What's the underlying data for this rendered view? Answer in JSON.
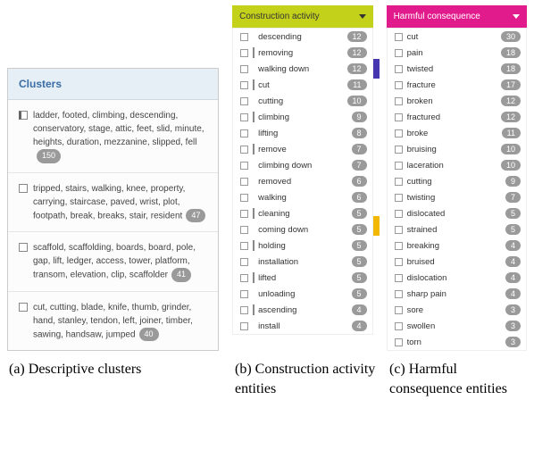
{
  "panelA": {
    "header": "Clusters",
    "items": [
      {
        "text": "ladder, footed, climbing, descending, conservatory, stage, attic, feet, slid, minute, heights, duration, mezzanine, slipped, fell",
        "count": "150",
        "bar": true
      },
      {
        "text": "tripped, stairs, walking, knee, property, carrying, staircase, paved, wrist, plot, footpath, break, breaks, stair, resident",
        "count": "47",
        "bar": false
      },
      {
        "text": "scaffold, scaffolding, boards, board, pole, gap, lift, ledger, access, tower, platform, transom, elevation, clip, scaffolder",
        "count": "41",
        "bar": false
      },
      {
        "text": "cut, cutting, blade, knife, thumb, grinder, hand, stanley, tendon, left, joiner, timber, sawing, handsaw, jumped",
        "count": "40",
        "bar": false
      }
    ]
  },
  "panelB": {
    "header": "Construction activity",
    "items": [
      {
        "text": "descending",
        "count": "12",
        "bar": false
      },
      {
        "text": "removing",
        "count": "12",
        "bar": true
      },
      {
        "text": "walking down",
        "count": "12",
        "bar": false
      },
      {
        "text": "cut",
        "count": "11",
        "bar": true
      },
      {
        "text": "cutting",
        "count": "10",
        "bar": false
      },
      {
        "text": "climbing",
        "count": "9",
        "bar": true
      },
      {
        "text": "lifting",
        "count": "8",
        "bar": false
      },
      {
        "text": "remove",
        "count": "7",
        "bar": true
      },
      {
        "text": "climbing down",
        "count": "7",
        "bar": false
      },
      {
        "text": "removed",
        "count": "6",
        "bar": false
      },
      {
        "text": "walking",
        "count": "6",
        "bar": false
      },
      {
        "text": "cleaning",
        "count": "5",
        "bar": true
      },
      {
        "text": "coming down",
        "count": "5",
        "bar": false
      },
      {
        "text": "holding",
        "count": "5",
        "bar": true
      },
      {
        "text": "installation",
        "count": "5",
        "bar": false
      },
      {
        "text": "lifted",
        "count": "5",
        "bar": true
      },
      {
        "text": "unloading",
        "count": "5",
        "bar": false
      },
      {
        "text": "ascending",
        "count": "4",
        "bar": true
      },
      {
        "text": "install",
        "count": "4",
        "bar": false
      }
    ]
  },
  "panelC": {
    "header": "Harmful consequence",
    "items": [
      {
        "text": "cut",
        "count": "30"
      },
      {
        "text": "pain",
        "count": "18"
      },
      {
        "text": "twisted",
        "count": "18"
      },
      {
        "text": "fracture",
        "count": "17"
      },
      {
        "text": "broken",
        "count": "12"
      },
      {
        "text": "fractured",
        "count": "12"
      },
      {
        "text": "broke",
        "count": "11"
      },
      {
        "text": "bruising",
        "count": "10"
      },
      {
        "text": "laceration",
        "count": "10"
      },
      {
        "text": "cutting",
        "count": "9"
      },
      {
        "text": "twisting",
        "count": "7"
      },
      {
        "text": "dislocated",
        "count": "5"
      },
      {
        "text": "strained",
        "count": "5"
      },
      {
        "text": "breaking",
        "count": "4"
      },
      {
        "text": "bruised",
        "count": "4"
      },
      {
        "text": "dislocation",
        "count": "4"
      },
      {
        "text": "sharp pain",
        "count": "4"
      },
      {
        "text": "sore",
        "count": "3"
      },
      {
        "text": "swollen",
        "count": "3"
      },
      {
        "text": "torn",
        "count": "3"
      }
    ]
  },
  "captions": {
    "a": "(a) Descriptive clusters",
    "b": "(b) Construction activity entities",
    "c": "(c) Harmful consequence entities"
  }
}
